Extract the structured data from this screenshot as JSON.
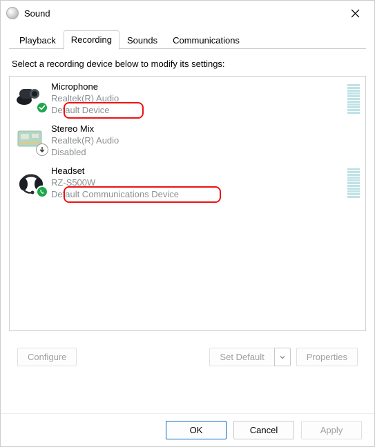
{
  "window": {
    "title": "Sound"
  },
  "tabs": {
    "playback": "Playback",
    "recording": "Recording",
    "sounds": "Sounds",
    "communications": "Communications",
    "active": "recording"
  },
  "instruction": "Select a recording device below to modify its settings:",
  "devices": [
    {
      "name": "Microphone",
      "sub1": "Realtek(R) Audio",
      "status": "Default Device"
    },
    {
      "name": "Stereo Mix",
      "sub1": "Realtek(R) Audio",
      "status": "Disabled"
    },
    {
      "name": "Headset",
      "sub1": "RZ-S500W",
      "status": "Default Communications Device"
    }
  ],
  "buttons": {
    "configure": "Configure",
    "set_default": "Set Default",
    "properties": "Properties",
    "ok": "OK",
    "cancel": "Cancel",
    "apply": "Apply"
  }
}
